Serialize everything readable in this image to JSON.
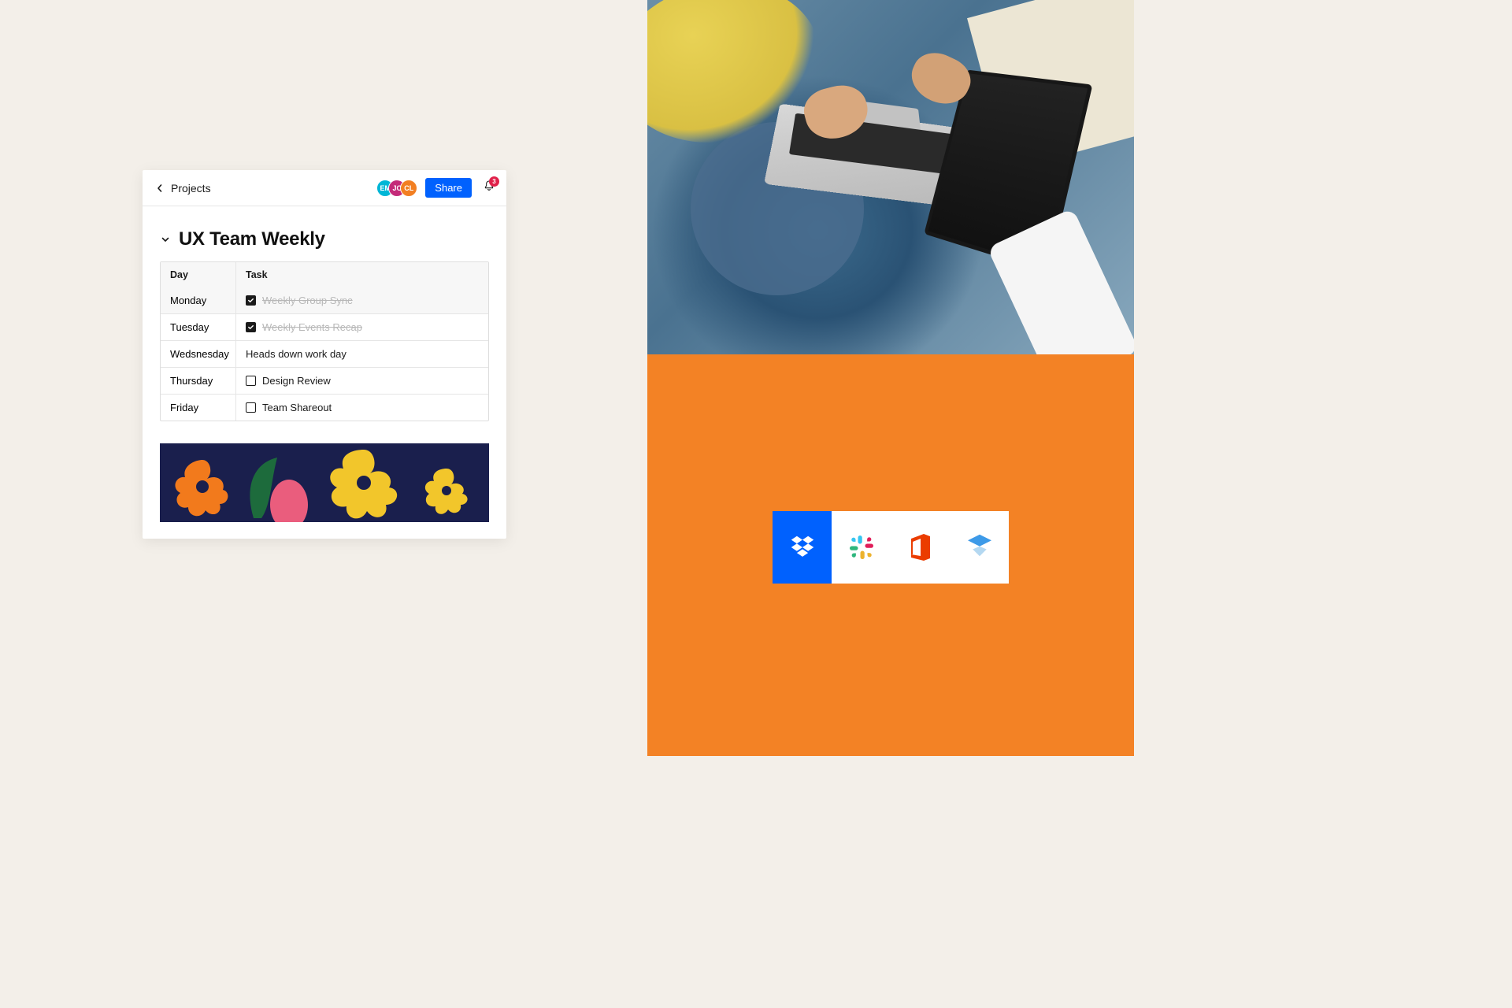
{
  "header": {
    "breadcrumb": "Projects",
    "share_label": "Share",
    "notification_count": "3",
    "avatars": [
      {
        "initials": "EM",
        "color": "#00b6d6"
      },
      {
        "initials": "JC",
        "color": "#c42a79"
      },
      {
        "initials": "CL",
        "color": "#f27f22"
      }
    ]
  },
  "page": {
    "title": "UX Team Weekly"
  },
  "table": {
    "columns": {
      "day": "Day",
      "task": "Task"
    },
    "rows": [
      {
        "day": "Monday",
        "task": "Weekly Group Sync",
        "checked": true,
        "has_checkbox": true
      },
      {
        "day": "Tuesday",
        "task": "Weekly Events Recap",
        "checked": true,
        "has_checkbox": true
      },
      {
        "day": "Wedsnesday",
        "task": "Heads down work day",
        "checked": false,
        "has_checkbox": false
      },
      {
        "day": "Thursday",
        "task": "Design Review",
        "checked": false,
        "has_checkbox": true
      },
      {
        "day": "Friday",
        "task": "Team Shareout",
        "checked": false,
        "has_checkbox": true
      }
    ]
  },
  "integrations": {
    "icons": [
      "dropbox-icon",
      "slack-icon",
      "office-icon",
      "paper-icon"
    ]
  },
  "colors": {
    "accent": "#0061fe",
    "orange_panel": "#f38225",
    "beige": "#f3efe9"
  }
}
